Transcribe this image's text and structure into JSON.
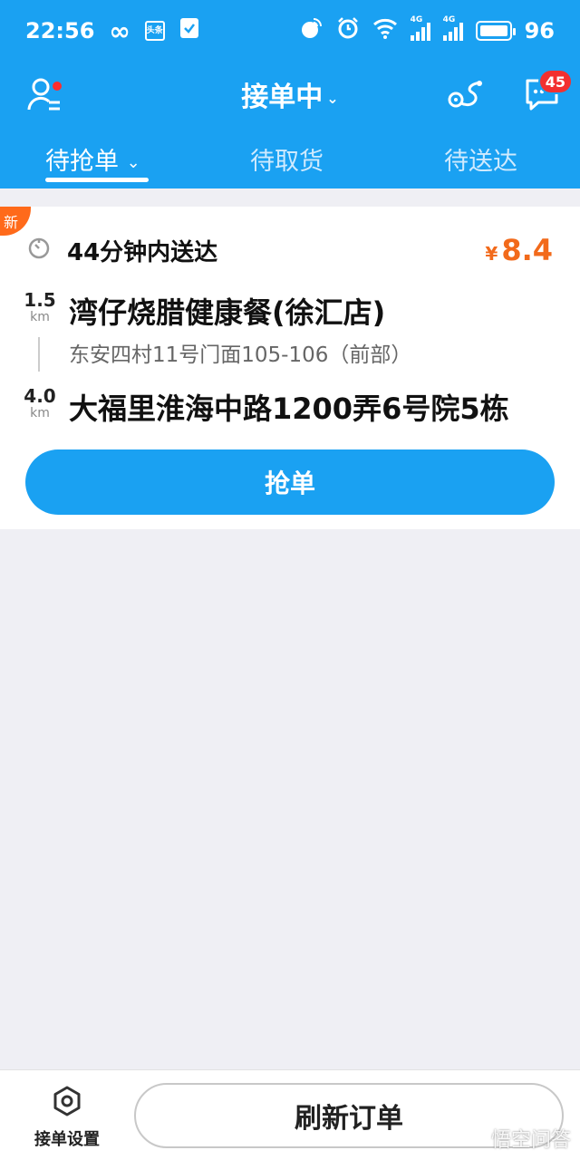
{
  "status_bar": {
    "time": "22:56",
    "infinity_glyph": "∞",
    "news_icon_text": "头条",
    "network_label_1": "4G",
    "network_label_2": "4G",
    "battery": "96"
  },
  "nav": {
    "title": "接单中",
    "title_chevron": "⌄",
    "message_badge": "45"
  },
  "tabs": [
    {
      "label": "待抢单",
      "active": true
    },
    {
      "label": "待取货",
      "active": false
    },
    {
      "label": "待送达",
      "active": false
    }
  ],
  "tab_chevron": "⌄",
  "order": {
    "new_tag": "新",
    "delivery_time": "44分钟内送达",
    "currency": "¥",
    "price": "8.4",
    "pickup_distance": "1.5",
    "pickup_unit": "km",
    "shop_name": "湾仔烧腊健康餐(徐汇店)",
    "shop_address": "东安四村11号门面105-106（前部）",
    "delivery_distance": "4.0",
    "delivery_unit": "km",
    "delivery_address": "大福里淮海中路1200弄6号院5栋",
    "grab_label": "抢单"
  },
  "footer": {
    "settings_label": "接单设置",
    "refresh_label": "刷新订单"
  },
  "watermark": "悟空问答",
  "colors": {
    "primary": "#1aa1f2",
    "price": "#f26a1b",
    "new_tag": "#ff6a1a",
    "badge": "#f23030"
  }
}
